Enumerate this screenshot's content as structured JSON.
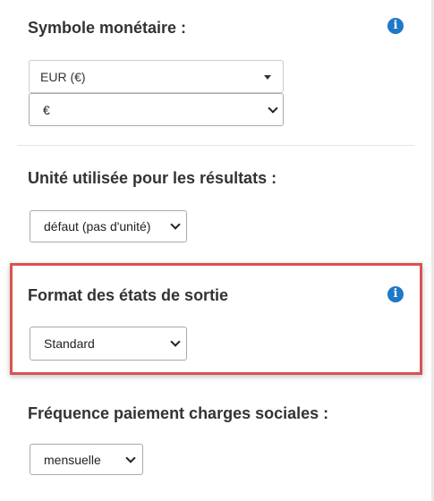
{
  "sections": {
    "currency": {
      "title": "Symbole monétaire :",
      "info_icon": "info-icon",
      "currency_dropdown_value": "EUR (€)",
      "symbol_select_value": "€"
    },
    "unit": {
      "title": "Unité utilisée pour les résultats :",
      "select_value": "défaut (pas d'unité)"
    },
    "format": {
      "title": "Format des états de sortie",
      "info_icon": "info-icon",
      "select_value": "Standard",
      "highlight_color": "#d9534f"
    },
    "frequency": {
      "title": "Fréquence paiement charges sociales :",
      "select_value": "mensuelle"
    }
  },
  "colors": {
    "info_icon": "#1f78c8",
    "text": "#333333",
    "highlight": "#d9534f"
  }
}
